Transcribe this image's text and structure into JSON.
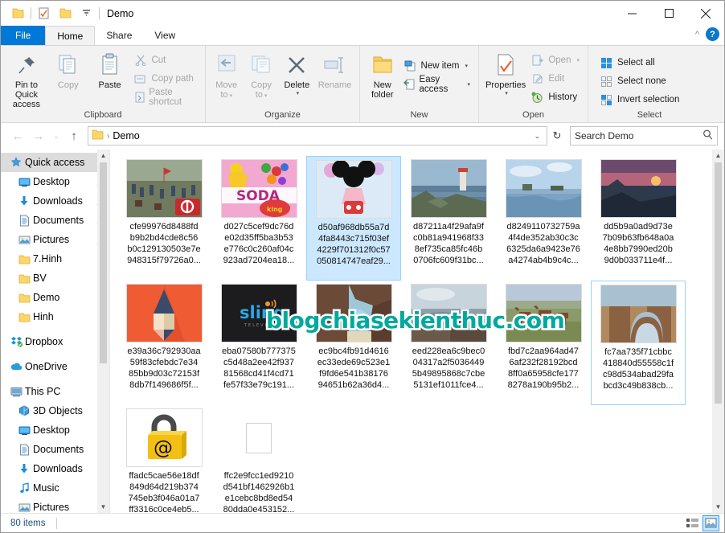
{
  "window": {
    "title": "Demo",
    "quick_access_toolbar": [
      "folder-icon",
      "properties-checklist-icon",
      "folder-icon",
      "dropdown-caret-icon"
    ],
    "controls": {
      "minimize": "–",
      "maximize": "☐",
      "close": "✕"
    },
    "collapse_ribbon": "^",
    "help": "?"
  },
  "tabs": [
    {
      "label": "File",
      "state": "file"
    },
    {
      "label": "Home",
      "state": "active"
    },
    {
      "label": "Share",
      "state": "normal"
    },
    {
      "label": "View",
      "state": "normal"
    }
  ],
  "ribbon": {
    "groups": [
      {
        "title": "Clipboard",
        "big_buttons": [
          {
            "label": "Pin to Quick\naccess",
            "icon": "pin-icon",
            "dim": false
          },
          {
            "label": "Copy",
            "icon": "copy-icon",
            "dim": true
          },
          {
            "label": "Paste",
            "icon": "paste-icon",
            "dim": false
          }
        ],
        "small_buttons": [
          {
            "label": "Cut",
            "icon": "scissors-icon",
            "dim": true
          },
          {
            "label": "Copy path",
            "icon": "copy-path-icon",
            "dim": true
          },
          {
            "label": "Paste shortcut",
            "icon": "paste-shortcut-icon",
            "dim": true
          }
        ]
      },
      {
        "title": "Organize",
        "big_buttons": [
          {
            "label": "Move\nto",
            "icon": "move-to-icon",
            "dim": true,
            "caret": true
          },
          {
            "label": "Copy\nto",
            "icon": "copy-to-icon",
            "dim": true,
            "caret": true
          },
          {
            "label": "Delete",
            "icon": "delete-x-icon",
            "dim": false,
            "caret": true
          },
          {
            "label": "Rename",
            "icon": "rename-icon",
            "dim": true
          }
        ],
        "small_buttons": []
      },
      {
        "title": "New",
        "big_buttons": [
          {
            "label": "New\nfolder",
            "icon": "new-folder-icon",
            "dim": false
          }
        ],
        "small_buttons": [
          {
            "label": "New item",
            "icon": "new-item-icon",
            "dim": false,
            "caret": true
          },
          {
            "label": "Easy access",
            "icon": "easy-access-icon",
            "dim": false,
            "caret": true
          }
        ]
      },
      {
        "title": "Open",
        "big_buttons": [
          {
            "label": "Properties",
            "icon": "properties-icon",
            "dim": false,
            "caret": true
          }
        ],
        "small_buttons": [
          {
            "label": "Open",
            "icon": "open-icon",
            "dim": true,
            "caret": true
          },
          {
            "label": "Edit",
            "icon": "edit-icon",
            "dim": true
          },
          {
            "label": "History",
            "icon": "history-icon",
            "dim": false
          }
        ]
      },
      {
        "title": "Select",
        "big_buttons": [],
        "small_buttons": [
          {
            "label": "Select all",
            "icon": "select-all-icon",
            "dim": false
          },
          {
            "label": "Select none",
            "icon": "select-none-icon",
            "dim": false
          },
          {
            "label": "Invert selection",
            "icon": "invert-selection-icon",
            "dim": false
          }
        ]
      }
    ]
  },
  "address_bar": {
    "back": "←",
    "forward": "→",
    "recent": "⌄",
    "up": "↑",
    "crumb_icon": "folder-icon",
    "crumb_separator": "›",
    "path": "Demo",
    "dropdown": "⌄",
    "refresh": "↻"
  },
  "search": {
    "placeholder": "Search Demo",
    "icon": "magnifier-icon"
  },
  "sidebar": {
    "items": [
      {
        "label": "Quick access",
        "icon": "quick-access-star-icon",
        "indent": 1,
        "selected": true,
        "pinned": false
      },
      {
        "label": "Desktop",
        "icon": "desktop-icon",
        "indent": 2,
        "selected": false,
        "pinned": true
      },
      {
        "label": "Downloads",
        "icon": "downloads-arrow-icon",
        "indent": 2,
        "selected": false,
        "pinned": true
      },
      {
        "label": "Documents",
        "icon": "documents-icon",
        "indent": 2,
        "selected": false,
        "pinned": true
      },
      {
        "label": "Pictures",
        "icon": "pictures-icon",
        "indent": 2,
        "selected": false,
        "pinned": true
      },
      {
        "label": "7.Hinh",
        "icon": "folder-icon",
        "indent": 2,
        "selected": false,
        "pinned": false
      },
      {
        "label": "BV",
        "icon": "folder-icon",
        "indent": 2,
        "selected": false,
        "pinned": false
      },
      {
        "label": "Demo",
        "icon": "folder-icon",
        "indent": 2,
        "selected": false,
        "pinned": false
      },
      {
        "label": "Hinh",
        "icon": "folder-icon",
        "indent": 2,
        "selected": false,
        "pinned": false
      },
      {
        "label": "Dropbox",
        "icon": "dropbox-icon",
        "indent": 1,
        "selected": false,
        "pinned": false,
        "gap_before": true
      },
      {
        "label": "OneDrive",
        "icon": "onedrive-cloud-icon",
        "indent": 1,
        "selected": false,
        "pinned": false,
        "gap_before": true
      },
      {
        "label": "This PC",
        "icon": "this-pc-icon",
        "indent": 1,
        "selected": false,
        "pinned": false,
        "gap_before": true
      },
      {
        "label": "3D Objects",
        "icon": "3d-objects-icon",
        "indent": 2,
        "selected": false,
        "pinned": false
      },
      {
        "label": "Desktop",
        "icon": "desktop-icon",
        "indent": 2,
        "selected": false,
        "pinned": false
      },
      {
        "label": "Documents",
        "icon": "documents-icon",
        "indent": 2,
        "selected": false,
        "pinned": false
      },
      {
        "label": "Downloads",
        "icon": "downloads-arrow-icon",
        "indent": 2,
        "selected": false,
        "pinned": false
      },
      {
        "label": "Music",
        "icon": "music-note-icon",
        "indent": 2,
        "selected": false,
        "pinned": false
      },
      {
        "label": "Pictures",
        "icon": "pictures-icon",
        "indent": 2,
        "selected": false,
        "pinned": false
      }
    ]
  },
  "files": {
    "watermark": "blogchiasekienthuc.com",
    "items": [
      {
        "name": "cfe99976d8488fd\nb9b2bd4cde8c56\nb0c129130503e7e\n948315f79726a0...",
        "thumb": "battle-scene",
        "state": "normal"
      },
      {
        "name": "d027c5cef9dc76d\ne02d35ff5ba3b53\ne776c0c260af04c\n923ad7204ea18...",
        "thumb": "candy-soda",
        "state": "normal"
      },
      {
        "name": "d50af968db55a7d\n4fa8443c715f03ef\n4229f701312f0c57\n050814747eaf29...",
        "thumb": "mickey-mouse",
        "state": "selected"
      },
      {
        "name": "d87211a4f29afa9f\nc0b81a941968f33\n8ef735ca85fc46b\n0706fc609f31bc...",
        "thumb": "lighthouse-coast",
        "state": "normal"
      },
      {
        "name": "d8249110732759a\n4f4de352ab30c3c\n6325da6a9423e76\na4274ab4b9c4c...",
        "thumb": "blue-sky-water",
        "state": "normal"
      },
      {
        "name": "dd5b9a0ad9d73e\n7b09b63fb648a0a\n4e8bb7990ed20b\n9d0b033711e4f...",
        "thumb": "mountain-sunset",
        "state": "normal"
      },
      {
        "name": "e39a36c792930aa\n59f83cfebdc7e34\n85bb9d03c72153f\n8db7f149686f5f...",
        "thumb": "pencil-orange",
        "state": "normal"
      },
      {
        "name": "eba07580b777375\nc5d48a2ee42f937\n81568cd41f4cd71\nfe57f33e79c191...",
        "thumb": "sling-logo",
        "state": "normal"
      },
      {
        "name": "ec9bc4fb91d4616\nec33ede69c523e1\nf9fd6e541b38176\n94651b62a36d4...",
        "thumb": "sea-arch",
        "state": "normal"
      },
      {
        "name": "eed228ea6c9bec0\n04317a2f5036449\n5b49895868c7cbe\n5131ef1011fce4...",
        "thumb": "rocky-shore",
        "state": "normal"
      },
      {
        "name": "fbd7c2aa964ad47\n6af232f28192bcd\n8ff0a65958cfe177\n8278a190b95b2...",
        "thumb": "horses-field",
        "state": "normal"
      },
      {
        "name": "fc7aa735f71cbbc\n418840d55558c1f\nc98d534abad29fa\nbcd3c49b838cb...",
        "thumb": "desert-arch",
        "state": "focused"
      },
      {
        "name": "ffadc5cae56e18df\n849d64d219b374\n745eb3f046a01a7\nff3316c0ce4eb5...",
        "thumb": "padlock-at",
        "state": "normal"
      },
      {
        "name": "ffc2e9fcc1ed9210\nd541bf1462926b1\ne1cebc8bd8ed54\n80dda0e453152...",
        "thumb": "blank-white",
        "state": "normal"
      }
    ]
  },
  "status": {
    "item_count": "80 items",
    "view_buttons": [
      {
        "icon": "details-view-icon",
        "active": false
      },
      {
        "icon": "large-icons-view-icon",
        "active": true
      }
    ]
  }
}
